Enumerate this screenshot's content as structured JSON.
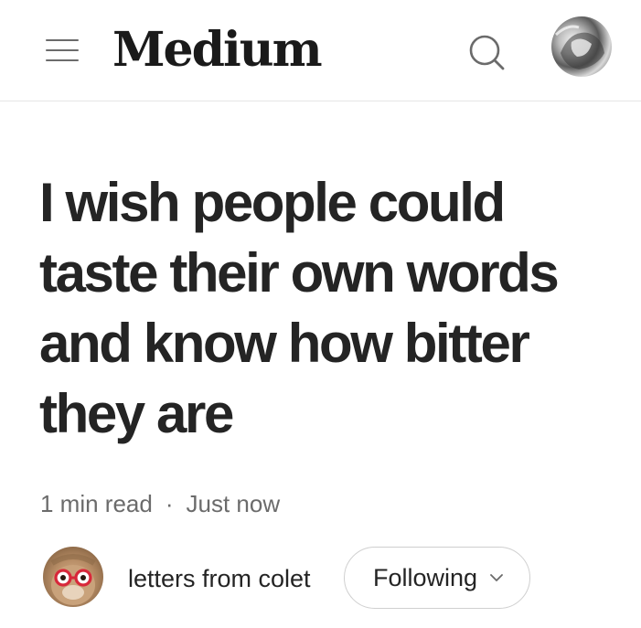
{
  "header": {
    "logo_text": "Medium",
    "menu_icon": "hamburger-menu-icon",
    "search_icon": "search-icon"
  },
  "article": {
    "title": "I wish people could taste their own words and know how bitter they are",
    "read_time": "1 min read",
    "separator": "·",
    "published": "Just now"
  },
  "author": {
    "name": "letters from colet",
    "follow_label": "Following"
  },
  "colors": {
    "text": "#242424",
    "muted": "#6b6b6b",
    "border": "#e6e6e6"
  }
}
